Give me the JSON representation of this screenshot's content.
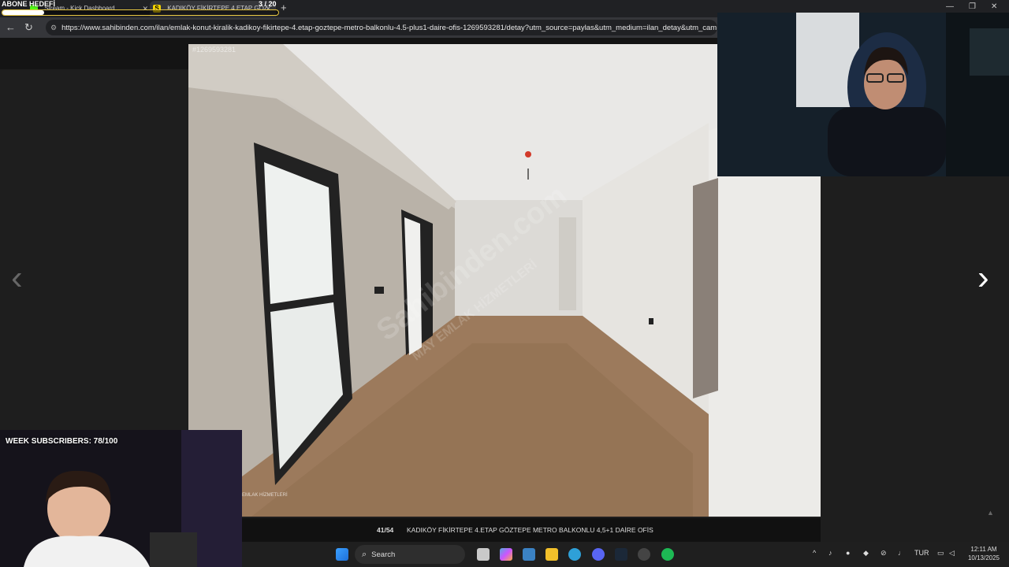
{
  "overlay": {
    "goal_label": "ABONE HEDEFİ",
    "goal_count": "3 / 20",
    "goal_fraction": 0.15,
    "week_subscribers": "WEEK SUBSCRIBERS: 78/100"
  },
  "browser": {
    "tabs": [
      {
        "label": "Stream - Kick Dashboard",
        "icon": "kick-icon"
      },
      {
        "label": "KADIKÖY FİKİRTEPE 4.ETAP GÖZ",
        "icon": "sahibinden-icon"
      }
    ],
    "url": "https://www.sahibinden.com/ilan/emlak-konut-kiralik-kadikoy-fikirtepe-4.etap-goztepe-metro-balkonlu-4.5-plus1-daire-ofis-1269593281/detay?utm_source=paylas&utm_medium=ilan_detay&utm_campaign"
  },
  "gallery": {
    "photo_id": "#1269593281",
    "watermark": "Sahibinden.com",
    "watermark_sub": "MAY EMLAK HİZMETLERİ",
    "logo_text": "EMLAK HİZMETLERİ",
    "counter": "41/54",
    "title": "KADIKÖY FİKİRTEPE 4.ETAP GÖZTEPE METRO BALKONLU 4,5+1 DAİRE OFİS",
    "prev_glyph": "‹",
    "next_glyph": "›"
  },
  "taskbar": {
    "search_placeholder": "Search",
    "language": "TUR",
    "time": "12:11 AM",
    "date": "10/13/2025"
  }
}
